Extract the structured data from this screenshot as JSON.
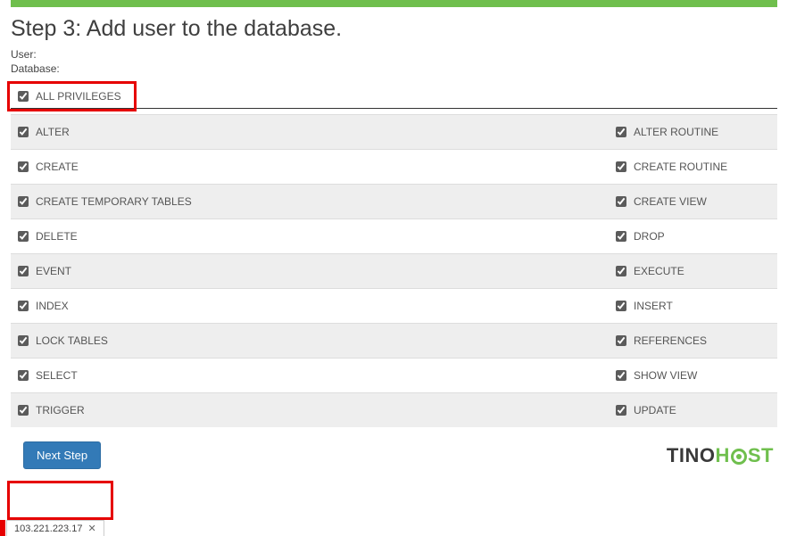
{
  "header": {
    "title": "Step 3: Add user to the database.",
    "user_label": "User:",
    "user_value": "",
    "database_label": "Database:",
    "database_value": ""
  },
  "all_privileges": {
    "label": "ALL PRIVILEGES",
    "checked": true
  },
  "privileges": [
    {
      "left": "ALTER",
      "right": "ALTER ROUTINE"
    },
    {
      "left": "CREATE",
      "right": "CREATE ROUTINE"
    },
    {
      "left": "CREATE TEMPORARY TABLES",
      "right": "CREATE VIEW"
    },
    {
      "left": "DELETE",
      "right": "DROP"
    },
    {
      "left": "EVENT",
      "right": "EXECUTE"
    },
    {
      "left": "INDEX",
      "right": "INSERT"
    },
    {
      "left": "LOCK TABLES",
      "right": "REFERENCES"
    },
    {
      "left": "SELECT",
      "right": "SHOW VIEW"
    },
    {
      "left": "TRIGGER",
      "right": "UPDATE"
    }
  ],
  "buttons": {
    "next_step": "Next Step"
  },
  "brand": {
    "part1": "TINO",
    "part2_prefix": "H",
    "part2_suffix": "ST"
  },
  "status": {
    "ip": "103.221.223.17"
  }
}
